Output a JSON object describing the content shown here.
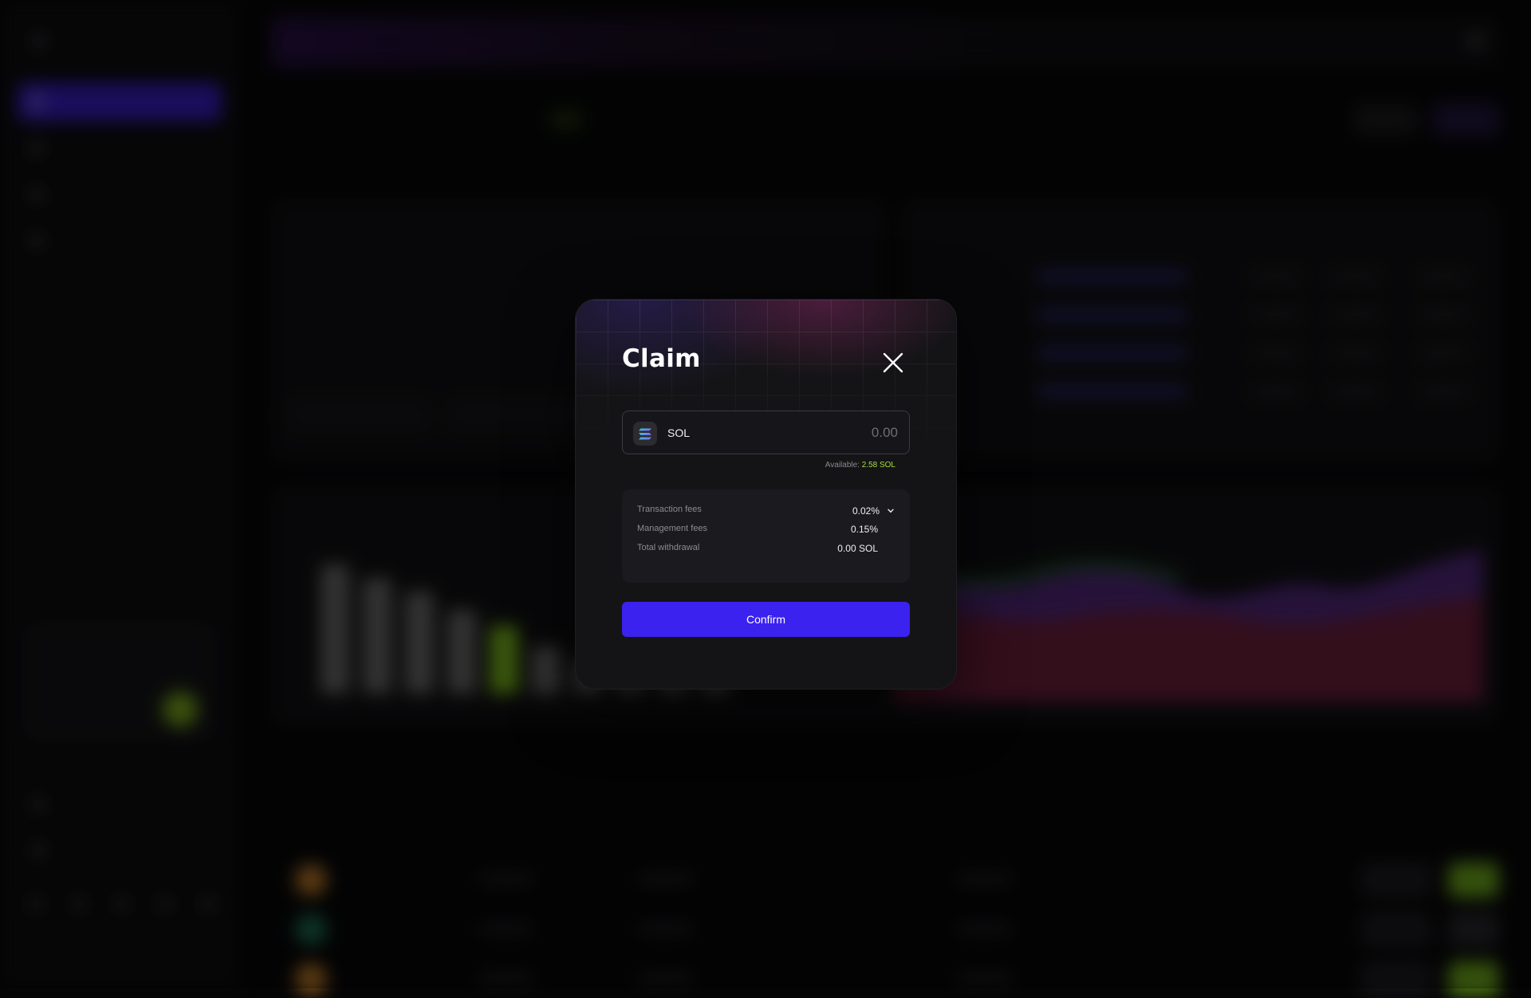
{
  "background": {
    "sidebar_items": [
      "",
      "",
      "",
      ""
    ],
    "accent": "#3d1fdc",
    "green": "#8cd11e",
    "bar_values": [
      0.95,
      0.85,
      0.75,
      0.62,
      0.5,
      0.35,
      0.25,
      0.2,
      0.18,
      0.15
    ],
    "highlighted_bar": 4
  },
  "modal": {
    "title": "Claim",
    "close_icon": "close-icon",
    "token": {
      "symbol": "SOL",
      "icon": "solana-icon"
    },
    "amount_placeholder": "0.00",
    "available_label": "Available:",
    "available_value": "2.58 SOL",
    "fees": [
      {
        "label": "Transaction fees",
        "value": "0.02%",
        "has_dropdown": true
      },
      {
        "label": "Management fees",
        "value": "0.15%"
      },
      {
        "label": "Total withdrawal",
        "value": "0.00 SOL"
      }
    ],
    "confirm_label": "Confirm",
    "colors": {
      "confirm": "#3b22ef",
      "available_value": "#a4e03a",
      "panel": "#141416"
    }
  }
}
